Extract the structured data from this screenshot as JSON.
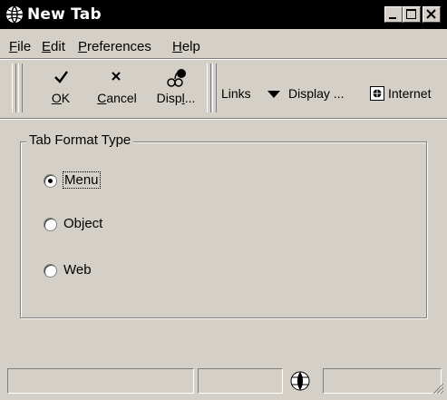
{
  "window": {
    "title": "New Tab"
  },
  "menu": [
    {
      "label": "File",
      "mnemonic": "F",
      "rest": "ile"
    },
    {
      "label": "Edit",
      "mnemonic": "E",
      "rest": "dit"
    },
    {
      "label": "Preferences",
      "mnemonic": "P",
      "rest": "references"
    },
    {
      "label": "Help",
      "mnemonic": "H",
      "rest": "elp"
    }
  ],
  "toolbar": {
    "ok": {
      "mnemonic": "O",
      "rest": "K"
    },
    "cancel": {
      "mnemonic": "C",
      "rest": "ancel"
    },
    "display": {
      "lead": "Disp",
      "mnemonic": "l",
      "rest": "..."
    },
    "links_label": "Links",
    "display_menu_label": "Display ...",
    "internet_label": "Internet"
  },
  "group": {
    "title": "Tab Format Type",
    "options": [
      {
        "label": "Menu",
        "checked": true
      },
      {
        "label": "Object",
        "checked": false
      },
      {
        "label": "Web",
        "checked": false
      }
    ]
  }
}
